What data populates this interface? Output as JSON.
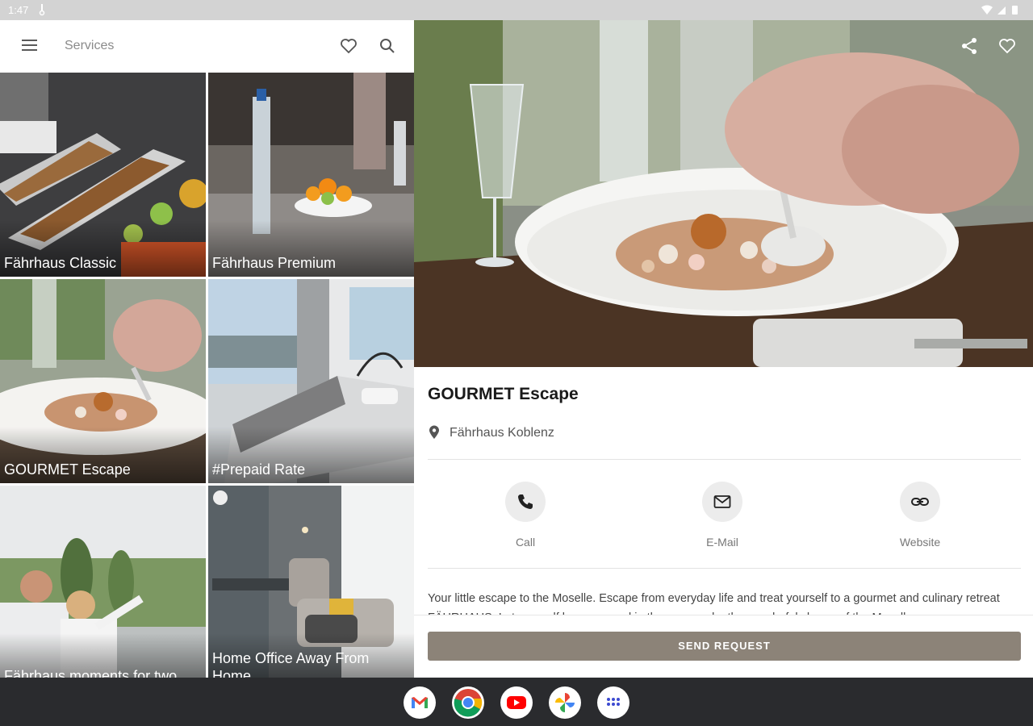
{
  "status_bar": {
    "time": "1:47"
  },
  "app_bar": {
    "title": "Services"
  },
  "tiles": [
    {
      "label": "Fährhaus Classic"
    },
    {
      "label": "Fährhaus Premium"
    },
    {
      "label": "GOURMET Escape"
    },
    {
      "label": "#Prepaid Rate"
    },
    {
      "label": "Fährhaus moments for two"
    },
    {
      "label": "Home Office Away From Home"
    }
  ],
  "detail": {
    "title": "GOURMET Escape",
    "location": "Fährhaus Koblenz",
    "actions": [
      {
        "label": "Call",
        "icon": "phone-icon"
      },
      {
        "label": "E-Mail",
        "icon": "mail-icon"
      },
      {
        "label": "Website",
        "icon": "link-icon"
      }
    ],
    "description": "Your little escape to the Moselle. Escape from everyday life and treat yourself to a gourmet and culinary retreat FÄHRHAUS. Let yourself be pampered in the summer by the wonderful shores of the Moselle.",
    "send_button": "SEND REQUEST"
  },
  "dock": [
    "gmail-icon",
    "chrome-icon",
    "youtube-icon",
    "photos-icon",
    "app-drawer-icon"
  ],
  "colors": {
    "accent_button": "#8c8378",
    "status_bar": "#d3d3d3",
    "nav_bar": "#2a2b2e"
  }
}
